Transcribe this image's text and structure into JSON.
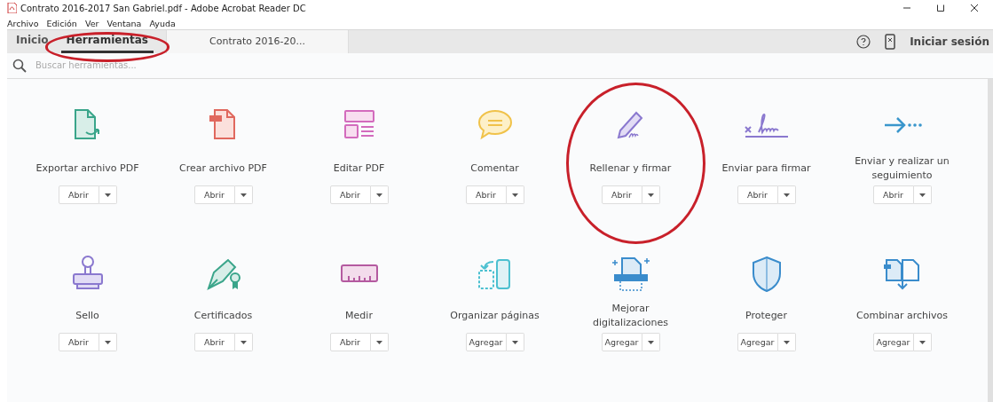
{
  "window": {
    "title": "Contrato 2016-2017 San Gabriel.pdf - Adobe Acrobat Reader DC"
  },
  "menu": [
    "Archivo",
    "Edición",
    "Ver",
    "Ventana",
    "Ayuda"
  ],
  "tabs": [
    {
      "label": "Inicio",
      "selected": false,
      "highlighted": false
    },
    {
      "label": "Herramientas",
      "selected": true,
      "highlighted": true
    },
    {
      "label": "Contrato 2016-20...",
      "selected": false,
      "highlighted": false
    }
  ],
  "sign_in": "Iniciar sesión",
  "search": {
    "placeholder": "Buscar herramientas..."
  },
  "tools": [
    {
      "label": "Exportar archivo PDF",
      "action": "Abrir",
      "highlighted": false
    },
    {
      "label": "Crear archivo PDF",
      "action": "Abrir",
      "highlighted": false
    },
    {
      "label": "Editar PDF",
      "action": "Abrir",
      "highlighted": false
    },
    {
      "label": "Comentar",
      "action": "Abrir",
      "highlighted": false
    },
    {
      "label": "Rellenar y firmar",
      "action": "Abrir",
      "highlighted": true
    },
    {
      "label": "Enviar para firmar",
      "action": "Abrir",
      "highlighted": false
    },
    {
      "label": "Enviar y realizar un seguimiento",
      "action": "Abrir",
      "highlighted": false
    },
    {
      "label": "Sello",
      "action": "Abrir",
      "highlighted": false
    },
    {
      "label": "Certificados",
      "action": "Abrir",
      "highlighted": false
    },
    {
      "label": "Medir",
      "action": "Abrir",
      "highlighted": false
    },
    {
      "label": "Organizar páginas",
      "action": "Agregar",
      "highlighted": false
    },
    {
      "label": "Mejorar digitalizaciones",
      "action": "Agregar",
      "highlighted": false
    },
    {
      "label": "Proteger",
      "action": "Agregar",
      "highlighted": false
    },
    {
      "label": "Combinar archivos",
      "action": "Agregar",
      "highlighted": false
    }
  ]
}
